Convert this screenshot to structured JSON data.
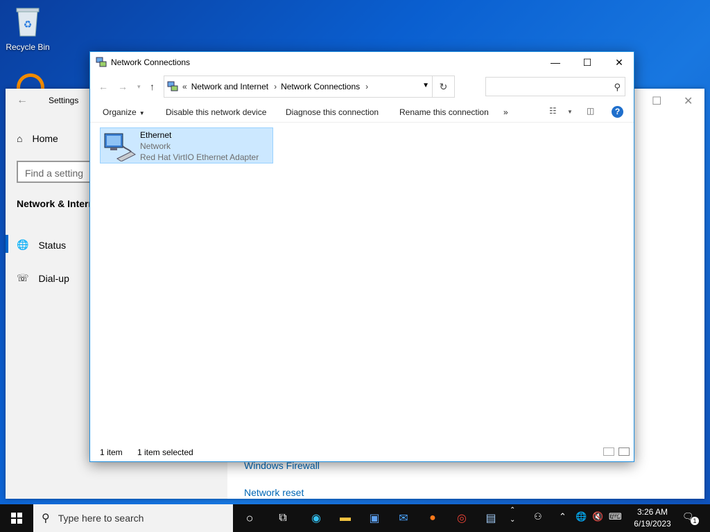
{
  "desktop": {
    "recycle_bin_label": "Recycle Bin"
  },
  "settings": {
    "title": "Settings",
    "home_label": "Home",
    "find_placeholder": "Find a setting",
    "section_label": "Network & Intern",
    "nav": [
      {
        "label": "Status"
      },
      {
        "label": "Dial-up"
      }
    ],
    "links": [
      {
        "label": "Windows Firewall"
      },
      {
        "label": "Network reset"
      }
    ]
  },
  "window": {
    "title": "Network Connections",
    "breadcrumb": [
      "Network and Internet",
      "Network Connections"
    ],
    "search_placeholder": "",
    "commands": {
      "organize": "Organize",
      "disable": "Disable this network device",
      "diagnose": "Diagnose this connection",
      "rename": "Rename this connection",
      "more": "»"
    },
    "item": {
      "name": "Ethernet",
      "network": "Network",
      "adapter": "Red Hat VirtIO Ethernet Adapter"
    },
    "status": {
      "count": "1 item",
      "selected": "1 item selected"
    }
  },
  "taskbar": {
    "search_placeholder": "Type here to search",
    "time": "3:26 AM",
    "date": "6/19/2023",
    "notification_count": "1"
  },
  "colors": {
    "accent": "#0078d7",
    "selection_bg": "#cce8ff",
    "link": "#0066b4"
  }
}
